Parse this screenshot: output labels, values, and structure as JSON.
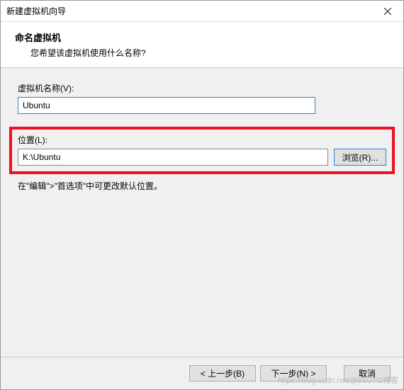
{
  "window": {
    "title": "新建虚拟机向导"
  },
  "header": {
    "heading": "命名虚拟机",
    "subheading": "您希望该虚拟机使用什么名称?"
  },
  "fields": {
    "name_label": "虚拟机名称(V):",
    "name_value": "Ubuntu",
    "location_label": "位置(L):",
    "location_value": "K:\\Ubuntu",
    "browse_label": "浏览(R)..."
  },
  "hint": "在\"编辑\">\"首选项\"中可更改默认位置。",
  "footer": {
    "back": "< 上一步(B)",
    "next": "下一步(N) >",
    "cancel": "取消"
  },
  "watermark": "https://blog.csdn.net/@51CTO博客"
}
